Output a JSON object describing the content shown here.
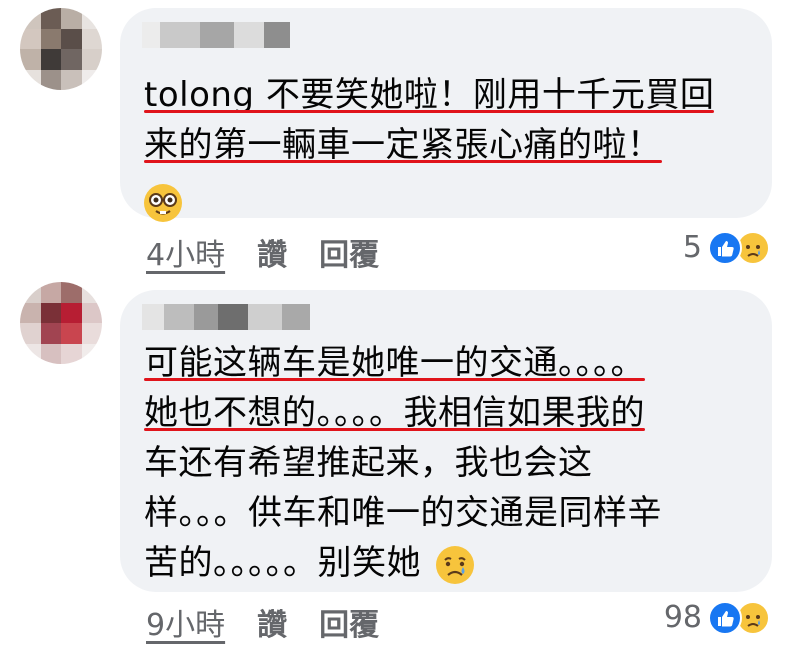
{
  "comments": [
    {
      "lines": [
        "tolong 不要笑她啦！刚用十千元買回",
        "来的第一輛車一定紧張心痛的啦！"
      ],
      "emoji": "nerd-face",
      "time": "4小時",
      "like_label": "讚",
      "reply_label": "回覆",
      "reaction_count": "5",
      "reactions": [
        "like",
        "sad"
      ]
    },
    {
      "lines": [
        "可能这辆车是她唯一的交通。。。。",
        "她也不想的。。。。我相信如果我的",
        "车还有希望推起来，我也会这",
        "样。。。供车和唯一的交通是同样辛",
        "苦的。。。。。别笑她"
      ],
      "emoji": "crying-face",
      "time": "9小時",
      "like_label": "讚",
      "reply_label": "回覆",
      "reaction_count": "98",
      "reactions": [
        "like",
        "sad"
      ]
    }
  ]
}
